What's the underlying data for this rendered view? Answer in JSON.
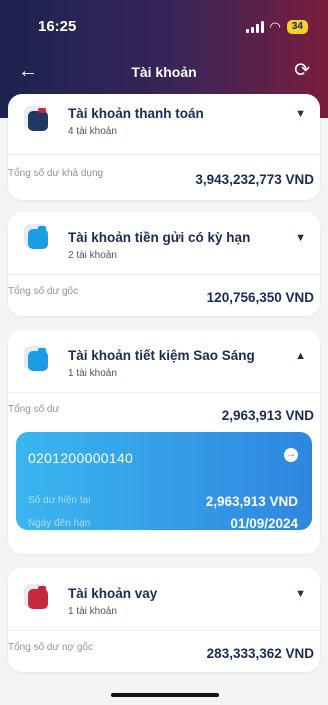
{
  "status": {
    "time": "16:25",
    "battery": "34"
  },
  "nav": {
    "title": "Tài khoản"
  },
  "accounts": [
    {
      "title": "Tài khoản thanh toán",
      "count": "4 tài khoản",
      "label": "Tổng số dư khả dụng",
      "amount": "3,943,232,773 VND",
      "color": "#233765",
      "expanded": false
    },
    {
      "title": "Tài khoản tiền gửi có kỳ hạn",
      "count": "2 tài khoản",
      "label": "Tổng số dư gốc",
      "amount": "120,756,350 VND",
      "color": "#1b9de6",
      "expanded": false
    },
    {
      "title": "Tài khoản tiết kiệm Sao Sáng",
      "count": "1 tài khoản",
      "label": "Tổng số dư",
      "amount": "2,963,913 VND",
      "color": "#1b9de6",
      "expanded": true
    },
    {
      "title": "Tài khoản vay",
      "count": "1 tài khoản",
      "label": "Tổng số dư nợ gốc",
      "amount": "283,333,362 VND",
      "color": "#c8283e",
      "expanded": false
    }
  ],
  "savings_detail": {
    "account_number": "0201200000140",
    "current_balance_label": "Số dư hiện tại",
    "current_balance": "2,963,913 VND",
    "due_date_label": "Ngày đến hạn",
    "due_date": "01/09/2024"
  },
  "icons": {
    "back": "arrow-left-icon",
    "refresh": "refresh-icon",
    "expand": "chevron-down-icon",
    "collapse": "chevron-up-icon",
    "go": "arrow-right-circle-icon"
  }
}
